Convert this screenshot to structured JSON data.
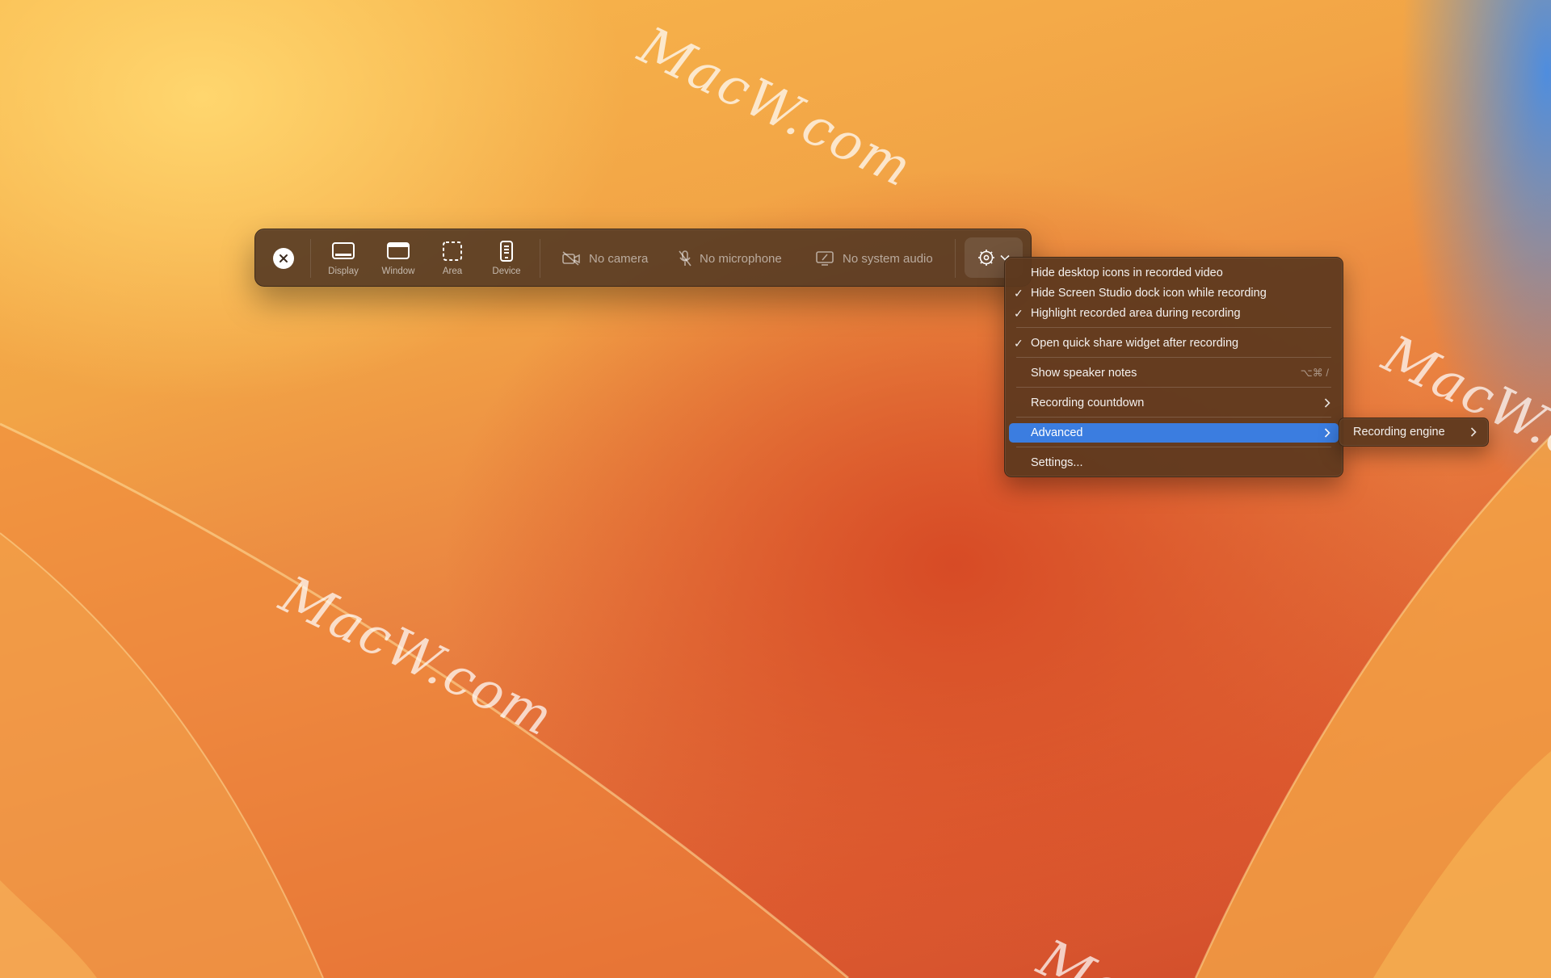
{
  "desktop": {
    "watermarks": [
      "MacW.com",
      "MacW.com",
      "MacW.com",
      "Ma"
    ]
  },
  "toolbar": {
    "close_icon": "close-icon",
    "modes": [
      {
        "label": "Display",
        "icon": "display-icon"
      },
      {
        "label": "Window",
        "icon": "window-icon"
      },
      {
        "label": "Area",
        "icon": "area-icon"
      },
      {
        "label": "Device",
        "icon": "device-icon"
      }
    ],
    "inputs": {
      "camera": "No camera",
      "microphone": "No microphone",
      "system_audio": "No system audio"
    },
    "settings_icon": "gear-icon"
  },
  "menu": {
    "items": [
      {
        "label": "Hide desktop icons in recorded video",
        "checked": false
      },
      {
        "label": "Hide Screen Studio dock icon while recording",
        "checked": true
      },
      {
        "label": "Highlight recorded area during recording",
        "checked": true
      },
      {
        "label": "Open quick share widget after recording",
        "checked": true
      },
      {
        "label": "Show speaker notes",
        "shortcut": "⌥⌘ /"
      },
      {
        "label": "Recording countdown",
        "submenu": true
      },
      {
        "label": "Advanced",
        "submenu": true,
        "highlighted": true
      },
      {
        "label": "Settings..."
      }
    ],
    "check_mark": "✓",
    "highlight_color": "#3b7de0"
  },
  "submenu": {
    "items": [
      {
        "label": "Recording engine",
        "submenu": true
      }
    ]
  }
}
